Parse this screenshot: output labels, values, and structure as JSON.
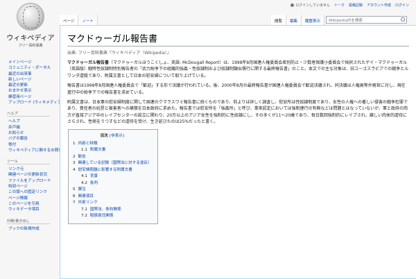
{
  "logo": {
    "wordmark": "ウィキペディア",
    "tagline": "フリー百科事典"
  },
  "personal": {
    "not_logged": "ログインしていません",
    "talk": "トーク",
    "contributions": "投稿記録",
    "create": "アカウント作成",
    "login": "ログイン"
  },
  "tabs": {
    "page": "ページ",
    "note": "ノート",
    "read": "閲覧",
    "edit": "編集",
    "history": "履歴表示"
  },
  "search": {
    "placeholder": "Wikipedia内を検索"
  },
  "article": {
    "title": "マクドゥーガル報告書",
    "site_sub": "出典: フリー百科事典『ウィキペディア（Wikipedia）』",
    "lead_bold": "マクドゥーガル報告書",
    "lead_rest": "（マクドゥーガルほうこくしょ、英語: McDougall Report）は、1998年8月国連人権委員会差別防止・少数者保護小委員会で採択されたゲイ・マクドゥーガル（英語版）戦時性奴隷制特別報告者の「武力紛争下の組織的強姦・性奴隷制および奴隷制類似慣行に関する最終報告書」のこと。本文での主な対象は、旧ユーゴスラビアでの戦争とルワンダ虐殺であり、附属文書として日本の慰安婦について取り上げている。",
    "p2": "報告書は1998年8月国連人権委員会で「歓迎」する形で決議が行われている。後、2000年8月の最終報告書が国連人権委員会で歓迎決議され、同決議は人権高等弁務官に対し、現在進行中の紛争下での報告書を求めている。",
    "p3": "附属文書は、日本軍の慰安婦制度に関して国連のクマラスワミ報告書に続くものであり、前よりは詳しく調査し、慰安所は性奴隷制度であり、女性の人権への著しい侵害の戦争犯罪であり、責任者の処罰と被害者への補償を日本政府に求めた。報告書では慰安所を「強姦所」と呼び、事実認定においては強制連行の有無などは問題とはなっていないが、軍と政府の両方が直接アジア中のレイプセンターの設立に関わり、20万以上のアジア女性を強制的に性奴隷にし、その多くが11〜20歳であり、毎日数回強制的にレイプされ、厳しい肉体的虐待にさらされ、性病をうつすなどの虐待を受け、生き延びたのは25%だったと書く。"
  },
  "toc": {
    "title": "目次",
    "toggle": "[非表示]",
    "items": [
      {
        "num": "1",
        "label": "内容と特徴",
        "level": 1
      },
      {
        "num": "1.1",
        "label": "附属文書",
        "level": 2
      },
      {
        "num": "2",
        "label": "勧告",
        "level": 1
      },
      {
        "num": "3",
        "label": "関連している記録（国際法に対する違反）",
        "level": 1
      },
      {
        "num": "4",
        "label": "慰安婦問題に影響する附属文書",
        "level": 1
      },
      {
        "num": "4.1",
        "label": "背景",
        "level": 2
      },
      {
        "num": "4.2",
        "label": "批判",
        "level": 2
      },
      {
        "num": "5",
        "label": "脚注",
        "level": 1
      },
      {
        "num": "6",
        "label": "関連項目",
        "level": 1
      },
      {
        "num": "7",
        "label": "外部リンク",
        "level": 1
      },
      {
        "num": "7.1",
        "label": "国際法、条約関係",
        "level": 2
      },
      {
        "num": "7.2",
        "label": "賠償責任関係",
        "level": 2
      }
    ]
  },
  "sidebar": {
    "nav": [
      "メインページ",
      "コミュニティ・ポータル",
      "最近の出来事",
      "新しいページ",
      "最近の更新",
      "おまかせ表示",
      "練習用ページ",
      "アップロード (ウィキメディア・コモンズ)"
    ],
    "help_heading": "ヘルプ",
    "help": [
      "ヘルプ",
      "井戸端",
      "お知らせ",
      "バグの報告",
      "寄付",
      "ウィキペディアに関するお問い合わせ"
    ],
    "tools_heading": "ツール",
    "tools": [
      "リンク元",
      "関連ページの更新状況",
      "ファイルをアップロード",
      "特別ページ",
      "この版への固定リンク",
      "ページ情報",
      "このページを引用",
      "ウィキデータ項目"
    ],
    "print_heading": "印刷/書き出し",
    "print": [
      "ブックの新規作成"
    ]
  }
}
